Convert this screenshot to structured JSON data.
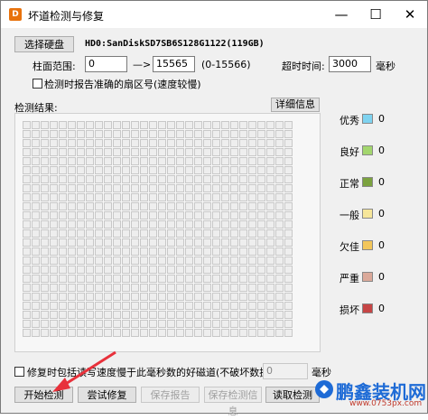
{
  "window": {
    "title": "坏道检测与修复",
    "app_icon_letter": "D",
    "min_glyph": "—",
    "max_glyph": "☐",
    "close_glyph": "✕"
  },
  "disk": {
    "select_button": "选择硬盘",
    "disk_name": "HD0:SanDiskSD7SB6S128G1122(119GB)"
  },
  "range": {
    "label": "柱面范围:",
    "start": "0",
    "arrow": "—>",
    "end": "15565",
    "hint": "(0-15566)",
    "timeout_label": "超时时间:",
    "timeout_value": "3000",
    "timeout_unit": "毫秒"
  },
  "options": {
    "report_sector_label": "检测时报告准确的扇区号(速度较慢)"
  },
  "results": {
    "label": "检测结果:",
    "details_button": "详细信息"
  },
  "legend": [
    {
      "label": "优秀",
      "color": "#7fd3f0",
      "count": "0"
    },
    {
      "label": "良好",
      "color": "#a3d66e",
      "count": "0"
    },
    {
      "label": "正常",
      "color": "#7ba23f",
      "count": "0"
    },
    {
      "label": "一般",
      "color": "#f6e69a",
      "count": "0"
    },
    {
      "label": "欠佳",
      "color": "#f3c65a",
      "count": "0"
    },
    {
      "label": "严重",
      "color": "#dba99a",
      "count": "0"
    },
    {
      "label": "损坏",
      "color": "#c64545",
      "count": "0"
    }
  ],
  "repair": {
    "label": "修复时包括读写速度慢于此毫秒数的好磁道(不破坏数据):",
    "value": "0",
    "unit": "毫秒"
  },
  "buttons": {
    "start": "开始检测",
    "try_repair": "尝试修复",
    "save_report": "保存报告",
    "save_info": "保存检测信息",
    "read_info": "读取检测"
  },
  "watermark": {
    "text": "鹏鑫装机网",
    "url": "www.0753px.com"
  },
  "colors": {
    "arrow": "#e8313b",
    "watermark_blue": "#1e6bd6"
  }
}
